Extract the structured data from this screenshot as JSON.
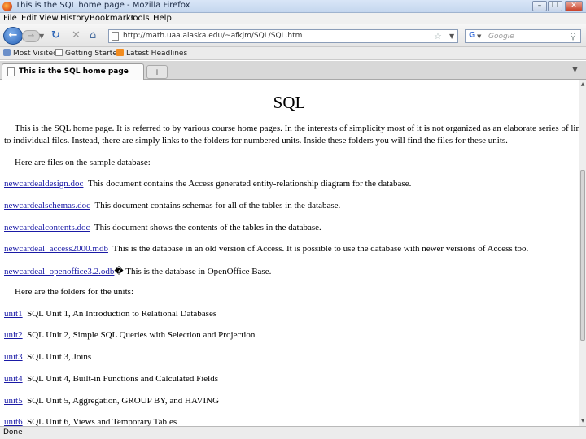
{
  "window": {
    "title": "This is the SQL home page - Mozilla Firefox",
    "minimize": "–",
    "restore": "❐",
    "close": "✕"
  },
  "menu": [
    "File",
    "Edit",
    "View",
    "History",
    "Bookmarks",
    "Tools",
    "Help"
  ],
  "nav": {
    "url": "http://math.uaa.alaska.edu/~afkjm/SQL/SQL.htm",
    "search_placeholder": "Google"
  },
  "bookmarks": [
    "Most Visited",
    "Getting Started",
    "Latest Headlines"
  ],
  "tabs": [
    {
      "label": "This is the SQL home page"
    }
  ],
  "page": {
    "heading": "SQL",
    "intro_1": "This is the SQL home page.  It is referred to by various course home pages.  In the interests of simplicity most of it is not organized as an elaborate series of links",
    "intro_2": "to individual files.  Instead, there are simply links to the folders for numbered units.  Inside these folders you will find the files for these units.",
    "files_heading": "Here are files on the sample database:",
    "files": [
      {
        "link": "newcardealdesign.doc",
        "text": "This document contains the Access generated entity-relationship diagram for the database."
      },
      {
        "link": "newcardealschemas.doc",
        "text": "This document contains schemas for all of the tables in the database."
      },
      {
        "link": "newcardealcontents.doc",
        "text": "This document shows the contents of the tables in the database."
      },
      {
        "link": "newcardeal_access2000.mdb",
        "text": "This is the database in an old version of Access.  It is possible to use the database with newer versions of Access too."
      },
      {
        "link": "newcardeal_openoffice3.2.odb",
        "text": "� This is the database in OpenOffice Base."
      }
    ],
    "folders_heading": "Here are the folders for the units:",
    "units": [
      {
        "link": "unit1",
        "text": "SQL Unit 1, An Introduction to Relational Databases"
      },
      {
        "link": "unit2",
        "text": "SQL Unit 2, Simple SQL Queries with Selection and Projection"
      },
      {
        "link": "unit3",
        "text": "SQL Unit 3, Joins"
      },
      {
        "link": "unit4",
        "text": "SQL Unit 4, Built-in Functions and Calculated Fields"
      },
      {
        "link": "unit5",
        "text": "SQL Unit 5, Aggregation, GROUP BY, and HAVING"
      },
      {
        "link": "unit6",
        "text": "SQL Unit 6, Views and Temporary Tables"
      }
    ]
  },
  "status": {
    "text": "Done"
  }
}
